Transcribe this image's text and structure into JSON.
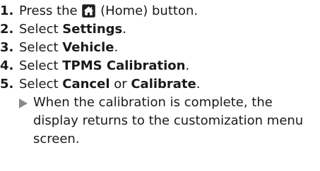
{
  "steps": [
    {
      "num": "1.",
      "pre": "Press the ",
      "icon": "home-icon",
      "post": " (Home) button."
    },
    {
      "num": "2.",
      "pre": "Select ",
      "bold": "Settings",
      "post": "."
    },
    {
      "num": "3.",
      "pre": "Select ",
      "bold": "Vehicle",
      "post": "."
    },
    {
      "num": "4.",
      "pre": "Select ",
      "bold": "TPMS Calibration",
      "post": "."
    },
    {
      "num": "5.",
      "pre": "Select ",
      "bold": "Cancel",
      "mid": " or ",
      "bold2": "Calibrate",
      "post": "."
    }
  ],
  "result": {
    "icon": "result-arrow-icon",
    "text": "When the calibration is complete, the display returns to the customization menu screen."
  },
  "colors": {
    "text": "#1a1a1a",
    "home_button_bg": "#1f1f1f",
    "arrow": "#8a8a8a"
  }
}
